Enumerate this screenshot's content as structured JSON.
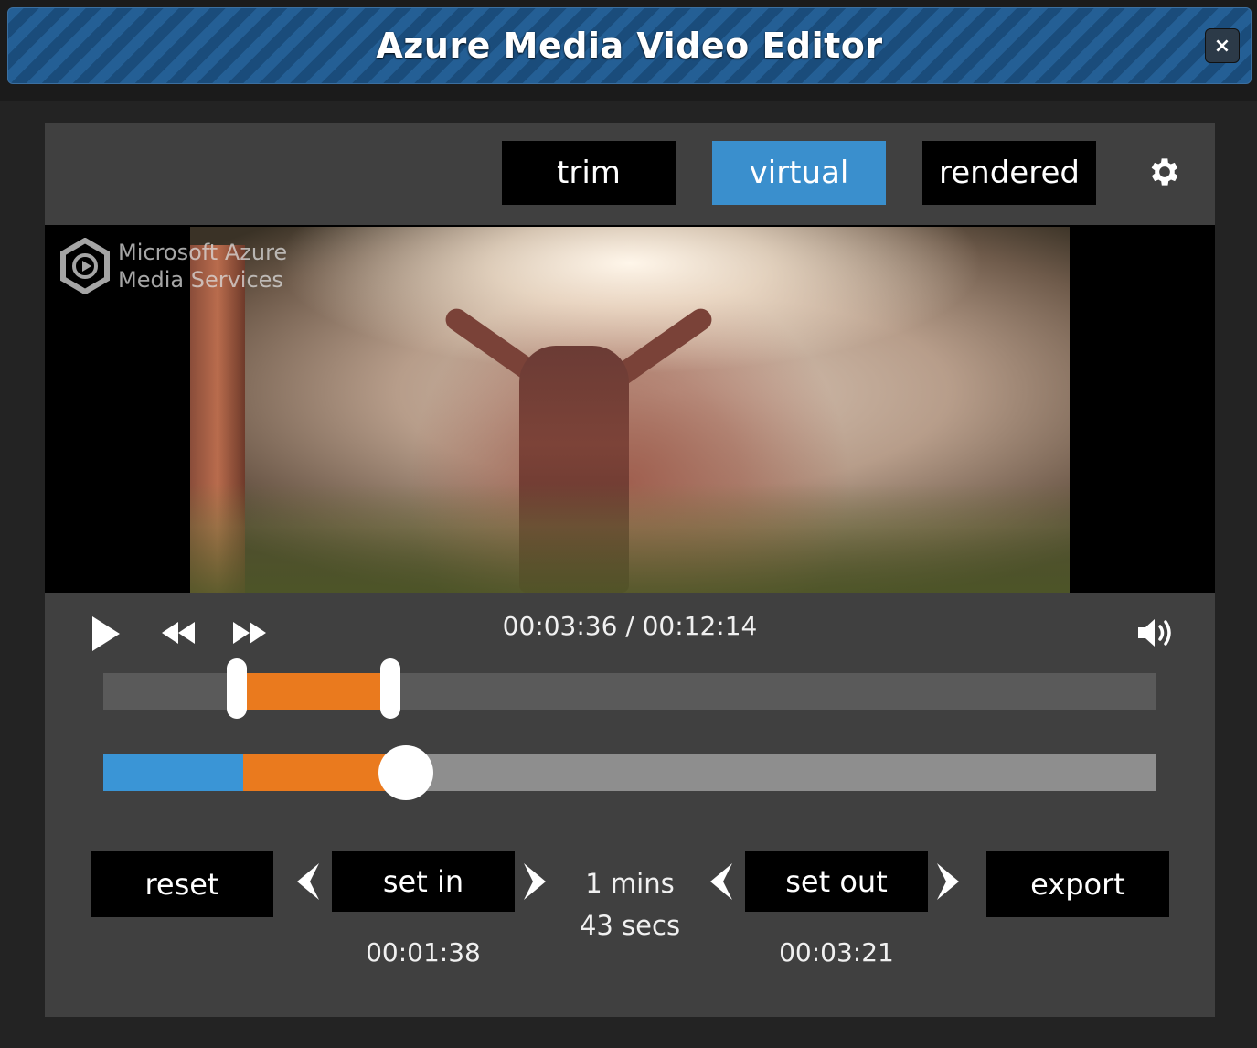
{
  "window": {
    "title": "Azure Media Video Editor",
    "close_label": "×"
  },
  "modes": {
    "trim": "trim",
    "virtual": "virtual",
    "rendered": "rendered",
    "active": "virtual"
  },
  "video": {
    "watermark_line1": "Microsoft Azure",
    "watermark_line2": "Media Services"
  },
  "player": {
    "time": "00:03:36 / 00:12:14",
    "range_start_fraction": 0.127,
    "range_end_fraction": 0.273,
    "scrub_blue_fraction": 0.133,
    "scrub_played_fraction": 0.287
  },
  "edit": {
    "reset_label": "reset",
    "set_in_label": "set in",
    "set_out_label": "set out",
    "export_label": "export",
    "in_time": "00:01:38",
    "out_time": "00:03:21",
    "duration_line1": "1 mins",
    "duration_line2": "43 secs"
  },
  "colors": {
    "accent_blue": "#3a8fcd",
    "range_orange": "#ea7a1e"
  },
  "icons": {
    "play": "play-icon",
    "rewind": "rewind-icon",
    "fast_forward": "fast-forward-icon",
    "volume": "volume-icon",
    "settings": "gear-icon",
    "close": "close-icon"
  }
}
